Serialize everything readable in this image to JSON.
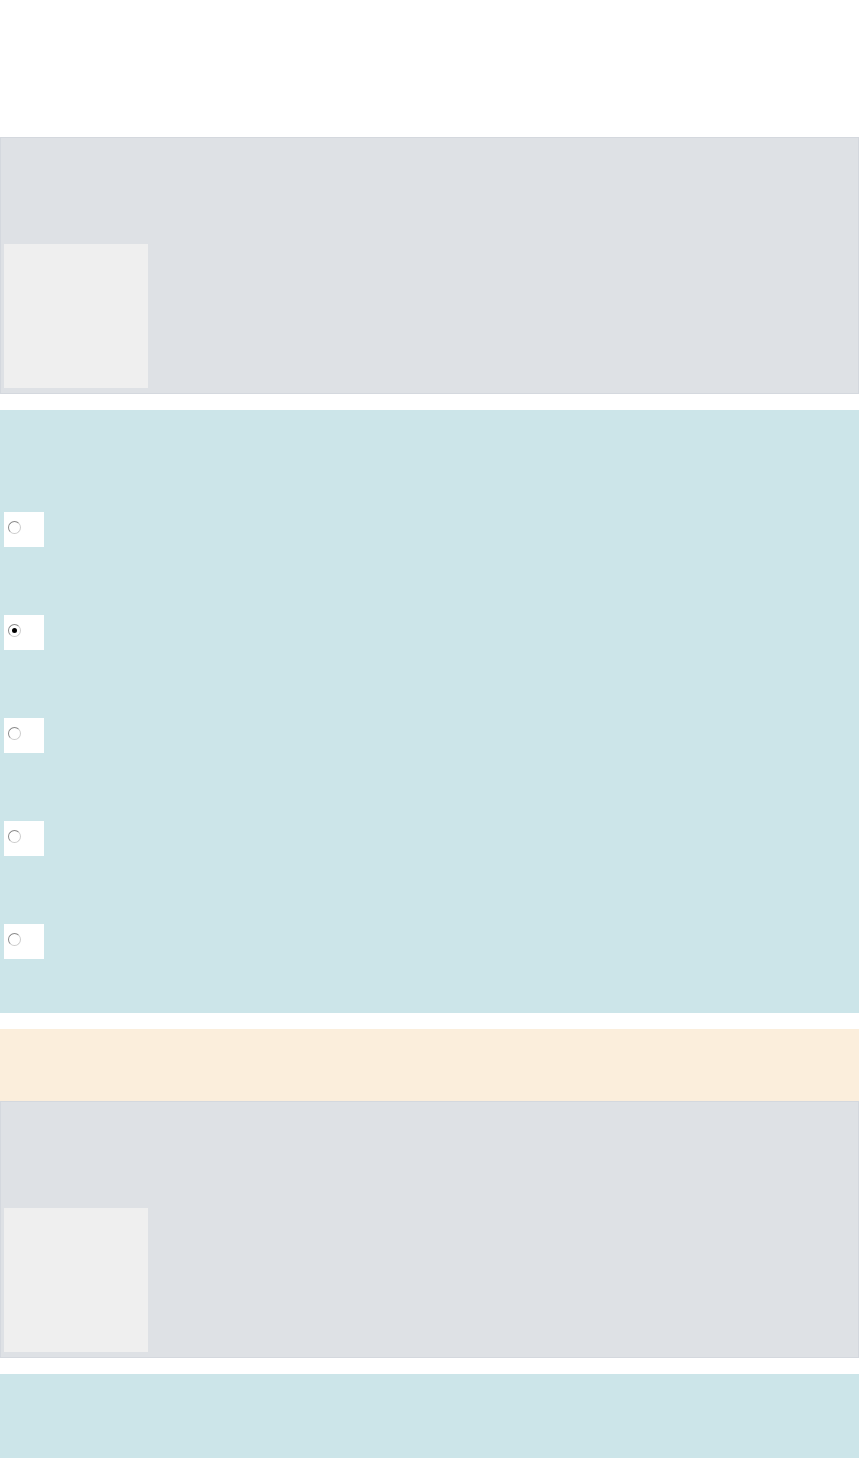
{
  "sections": [
    {
      "kind": "question"
    },
    {
      "kind": "options",
      "options": [
        {
          "selected": false
        },
        {
          "selected": true
        },
        {
          "selected": false
        },
        {
          "selected": false
        },
        {
          "selected": false
        }
      ]
    },
    {
      "kind": "note"
    },
    {
      "kind": "question"
    },
    {
      "kind": "options"
    }
  ]
}
